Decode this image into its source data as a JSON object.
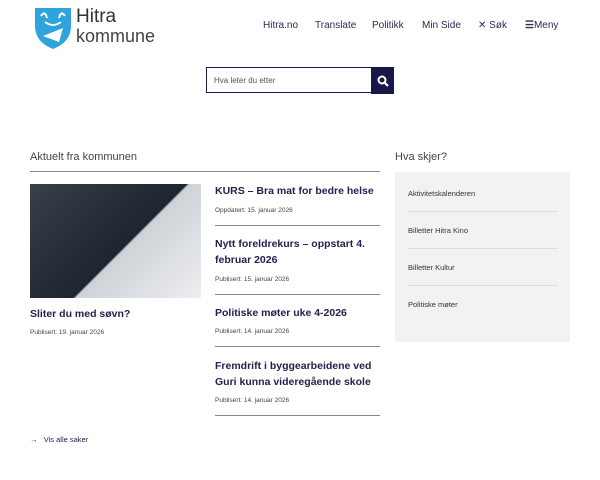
{
  "header": {
    "logo_line1": "Hitra",
    "logo_line2": "kommune",
    "nav": [
      "Hitra.no",
      "Translate",
      "Politikk",
      "Min Side",
      "Søk",
      "Meny"
    ]
  },
  "search": {
    "placeholder": "Hva leter du etter"
  },
  "news": {
    "heading": "Aktuelt fra kommunen",
    "featured": {
      "title": "Sliter du med søvn?",
      "meta": "Publisert: 19. januar 2026"
    },
    "items": [
      {
        "title": "KURS – Bra mat for bedre helse",
        "meta": "Oppdatert: 15. januar 2026"
      },
      {
        "title": "Nytt foreldrekurs – oppstart 4. februar 2026",
        "meta": "Publisert: 15. januar 2026"
      },
      {
        "title": "Politiske møter uke 4-2026",
        "meta": "Publisert: 14. januar 2026"
      },
      {
        "title": "Fremdrift i byggearbeidene ved Guri kunna videregående skole",
        "meta": "Publisert: 14. januar 2026"
      }
    ],
    "all_link": "Vis alle saker"
  },
  "events": {
    "heading": "Hva skjer?",
    "items": [
      "Aktivitetskalenderen",
      "Billetter Hitra Kino",
      "Billetter Kultur",
      "Politiske møter"
    ]
  }
}
